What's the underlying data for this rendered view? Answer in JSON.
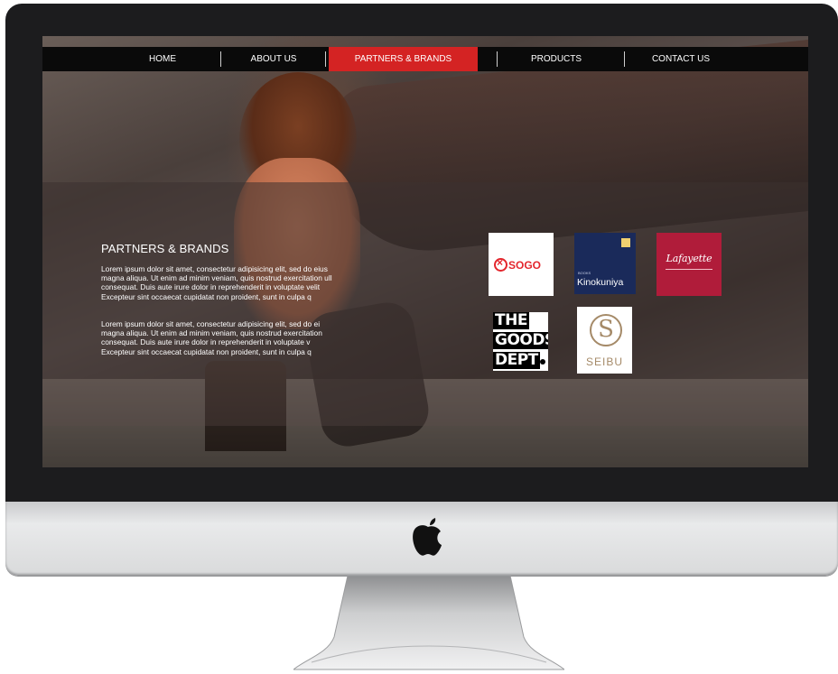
{
  "nav": {
    "items": [
      {
        "label": "HOME"
      },
      {
        "label": "ABOUT US"
      },
      {
        "label": "PARTNERS & BRANDS",
        "active": true
      },
      {
        "label": "PRODUCTS"
      },
      {
        "label": "CONTACT US"
      }
    ],
    "active_color": "#d42323"
  },
  "content": {
    "title": "PARTNERS & BRANDS",
    "paragraphs": [
      "Lorem ipsum dolor sit amet, consectetur adipisicing elit, sed do eius\nmagna aliqua. Ut enim ad minim veniam, quis nostrud exercitation ull\nconsequat. Duis aute irure dolor in reprehenderit in voluptate velit\nExcepteur sint occaecat cupidatat non proident, sunt in culpa q",
      "Lorem ipsum dolor sit amet, consectetur adipisicing elit, sed do ei\nmagna aliqua. Ut enim ad minim veniam, quis nostrud exercitation\nconsequat. Duis aute irure dolor in reprehenderit in voluptate v\nExcepteur sint occaecat cupidatat non proident, sunt in culpa q"
    ]
  },
  "brands": {
    "sogo": {
      "name": "SOGO",
      "color": "#e3262d"
    },
    "kinokuniya": {
      "small": "BOOKS",
      "name": "Kinokuniya",
      "color": "#1a2a5a"
    },
    "lafayette": {
      "name": "Lafayette",
      "color": "#b01c3a"
    },
    "goods": {
      "line1": "THE",
      "line2": "GOODS",
      "line3": "DEPT"
    },
    "seibu": {
      "name": "SEIBU",
      "color": "#a58a68"
    }
  }
}
